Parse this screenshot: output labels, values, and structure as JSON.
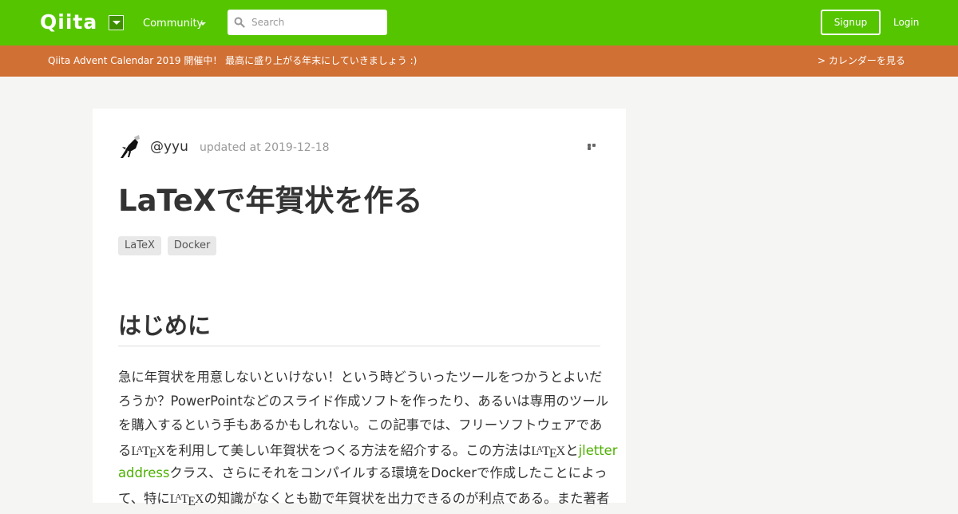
{
  "header": {
    "logo": "Qiita",
    "community_label": "Community",
    "search_placeholder": "Search",
    "signup_label": "Signup",
    "login_label": "Login",
    "colors": {
      "brand": "#55c500",
      "banner": "#d17034"
    }
  },
  "banner": {
    "text": "Qiita Advent Calendar 2019 開催中！ 最高に盛り上がる年末にしていきましょう :)",
    "link": "> カレンダーを見る"
  },
  "article": {
    "author": "@yyu",
    "updated": "updated at 2019-12-18",
    "title": "LaTeXで年賀状を作る",
    "tags": [
      "LaTeX",
      "Docker"
    ],
    "section_heading": "はじめに",
    "latex_logo": {
      "l": "L",
      "a": "A",
      "t": "T",
      "e": "E",
      "x": "X"
    },
    "paragraph": {
      "line1": "急に年賀状を用意しないといけない！という時どういったツールをつかうとよいだ",
      "line2": "ろうか？PowerPointなどのスライド作成ソフトを作ったり、あるいは専用のツール",
      "line3": "を購入するという手もあるかもしれない。この記事では、フリーソフトウェアであ",
      "line4_a": "る",
      "line4_b": "を利用して美しい年賀状をつくる方法を紹介する。この方法は",
      "line4_c": "と",
      "line4_link": "jletter",
      "line5_link": "address",
      "line5_b": "クラス、さらにそれをコンパイルする環境をDockerで作成したことによっ",
      "line6_a": "て、特に",
      "line6_b": "の知識がなくとも勘で年賀状を出力できるのが利点である。また著者"
    }
  }
}
